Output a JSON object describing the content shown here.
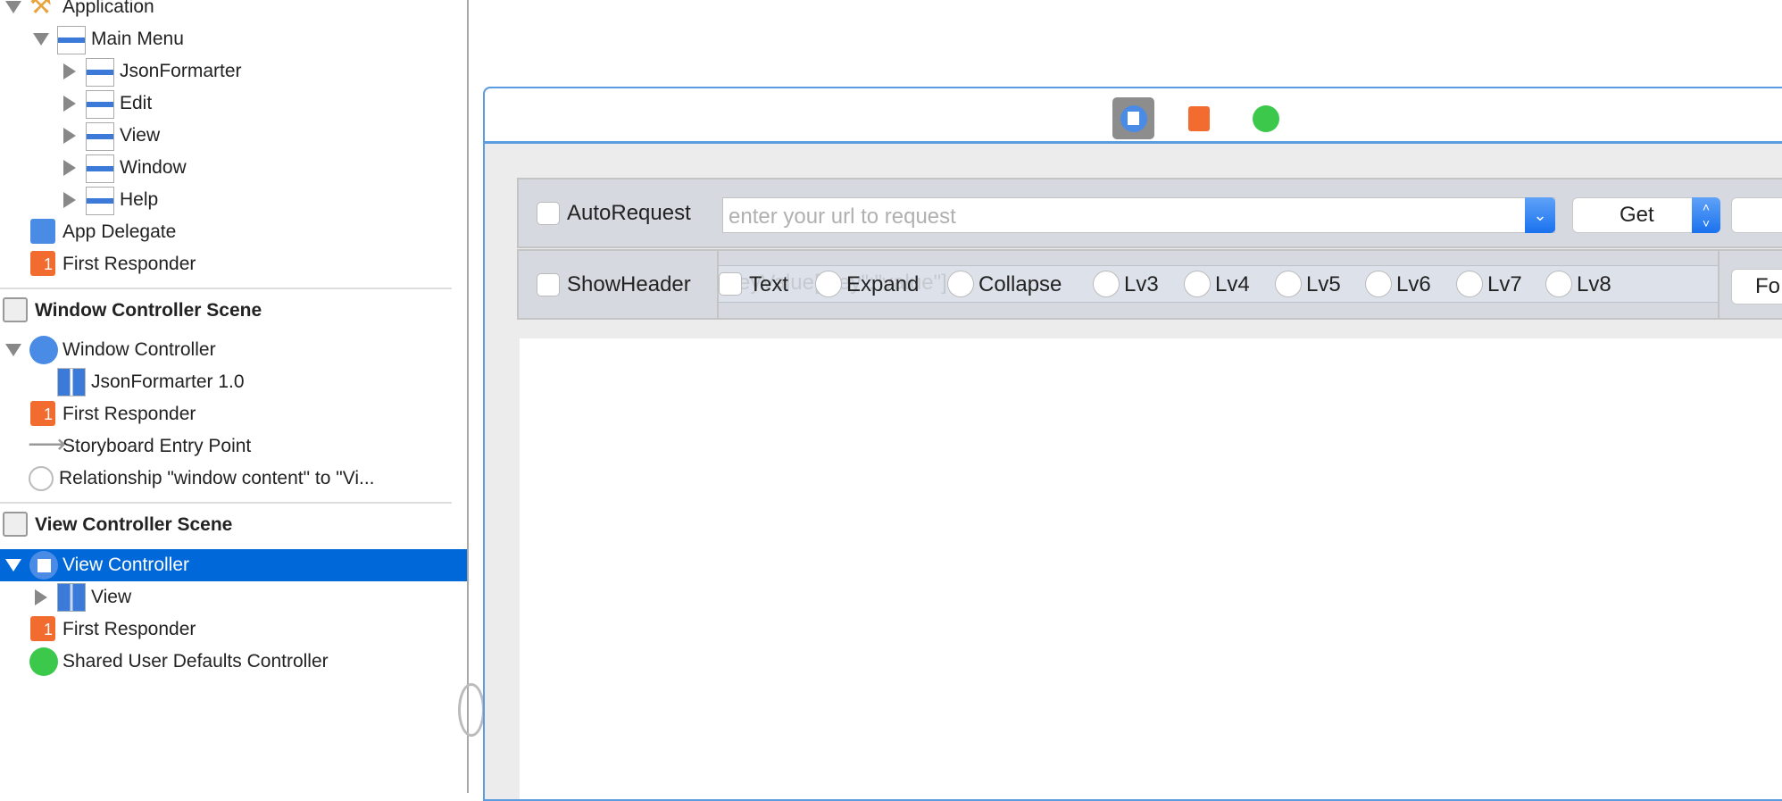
{
  "outline": {
    "application": "Application",
    "main_menu": "Main Menu",
    "menus": [
      "JsonFormarter",
      "Edit",
      "View",
      "Window",
      "Help"
    ],
    "app_delegate": "App Delegate",
    "first_responder": "First Responder",
    "window_scene": {
      "title": "Window Controller Scene",
      "window_controller": "Window Controller",
      "window": "JsonFormarter 1.0",
      "first_responder": "First Responder",
      "entry_point": "Storyboard Entry Point",
      "relationship": "Relationship \"window content\" to \"Vi..."
    },
    "view_scene": {
      "title": "View Controller Scene",
      "view_controller": "View Controller",
      "view": "View",
      "first_responder": "First Responder",
      "defaults": "Shared User Defaults Controller"
    }
  },
  "canvas": {
    "auto_request": "AutoRequest",
    "url_placeholder": "enter your url to request",
    "method": "Get",
    "show_header": "ShowHeader",
    "ghost_text": "eyValue[\"key\":\"value\"]",
    "options": [
      "Text",
      "Expand",
      "Collapse",
      "Lv3",
      "Lv4",
      "Lv5",
      "Lv6",
      "Lv7",
      "Lv8"
    ],
    "format_button": "Fo"
  },
  "colors": {
    "selection": "#0068d8",
    "accent": "#5b9be0",
    "first_responder": "#f26b2f",
    "defaults": "#3cc84a"
  }
}
